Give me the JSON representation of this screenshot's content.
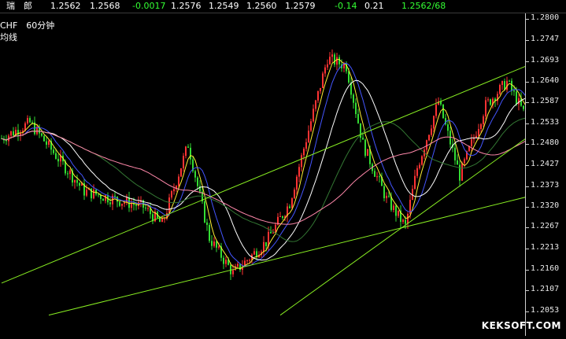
{
  "quote_bar": {
    "name": "瑞　郎",
    "fields": [
      {
        "text": "1.2562",
        "color": "#ffffff"
      },
      {
        "text": "1.2568",
        "color": "#ffffff"
      },
      {
        "text": "-0.0017",
        "color": "#33ff33"
      },
      {
        "text": "1.2576",
        "color": "#ffffff"
      },
      {
        "text": "1.2549",
        "color": "#ffffff"
      },
      {
        "text": "1.2560",
        "color": "#ffffff"
      },
      {
        "text": "1.2579",
        "color": "#ffffff"
      },
      {
        "text": "-0.14",
        "color": "#33ff33"
      },
      {
        "text": "0.21",
        "color": "#ffffff"
      },
      {
        "text": "1.2562/68",
        "color": "#33ff33"
      }
    ]
  },
  "overlay": {
    "symbol_period": "CHF　60分钟",
    "indicator": "均线"
  },
  "watermark": "KEKSOFT.COM",
  "colors": {
    "up_candle": "#ff3333",
    "down_candle": "#33dd33",
    "trendline": "#88ee22",
    "ma_white": "#ffffff",
    "ma_yellow": "#ffee33",
    "ma_blue": "#4455ff",
    "ma_pink": "#ff88aa",
    "ma_dark_green": "#337733"
  },
  "chart_data": {
    "type": "candlestick",
    "symbol": "CHF",
    "period": "60分钟",
    "ylim": [
      1.199,
      1.2815
    ],
    "y_ticks": [
      "1.2800",
      "1.2747",
      "1.2693",
      "1.2640",
      "1.2587",
      "1.2533",
      "1.2480",
      "1.2427",
      "1.2373",
      "1.2320",
      "1.2267",
      "1.2213",
      "1.2160",
      "1.2107",
      "1.2053"
    ],
    "key_prices": [
      {
        "bar": 0,
        "price": 1.2495
      },
      {
        "bar": 12,
        "price": 1.2535
      },
      {
        "bar": 35,
        "price": 1.236
      },
      {
        "bar": 60,
        "price": 1.232
      },
      {
        "bar": 68,
        "price": 1.2275
      },
      {
        "bar": 79,
        "price": 1.248
      },
      {
        "bar": 88,
        "price": 1.224
      },
      {
        "bar": 98,
        "price": 1.215
      },
      {
        "bar": 112,
        "price": 1.223
      },
      {
        "bar": 122,
        "price": 1.233
      },
      {
        "bar": 128,
        "price": 1.247
      },
      {
        "bar": 138,
        "price": 1.27
      },
      {
        "bar": 146,
        "price": 1.268
      },
      {
        "bar": 153,
        "price": 1.248
      },
      {
        "bar": 163,
        "price": 1.234
      },
      {
        "bar": 171,
        "price": 1.227
      },
      {
        "bar": 176,
        "price": 1.242
      },
      {
        "bar": 185,
        "price": 1.259
      },
      {
        "bar": 194,
        "price": 1.24
      },
      {
        "bar": 205,
        "price": 1.258
      },
      {
        "bar": 214,
        "price": 1.264
      },
      {
        "bar": 221,
        "price": 1.2562
      }
    ],
    "trendlines": [
      {
        "from": {
          "bar": 0,
          "price": 1.2125
        },
        "to": {
          "bar": 222,
          "price": 1.268
        }
      },
      {
        "from": {
          "bar": 20,
          "price": 1.2043
        },
        "to": {
          "bar": 222,
          "price": 1.2345
        }
      },
      {
        "from": {
          "bar": 118,
          "price": 1.2043
        },
        "to": {
          "bar": 222,
          "price": 1.2495
        }
      }
    ],
    "moving_averages": [
      {
        "color": "ma_yellow",
        "period": 5
      },
      {
        "color": "ma_blue",
        "period": 10
      },
      {
        "color": "ma_white",
        "period": 20
      },
      {
        "color": "ma_dark_green",
        "period": 40
      },
      {
        "color": "ma_pink",
        "period": 60
      }
    ]
  }
}
